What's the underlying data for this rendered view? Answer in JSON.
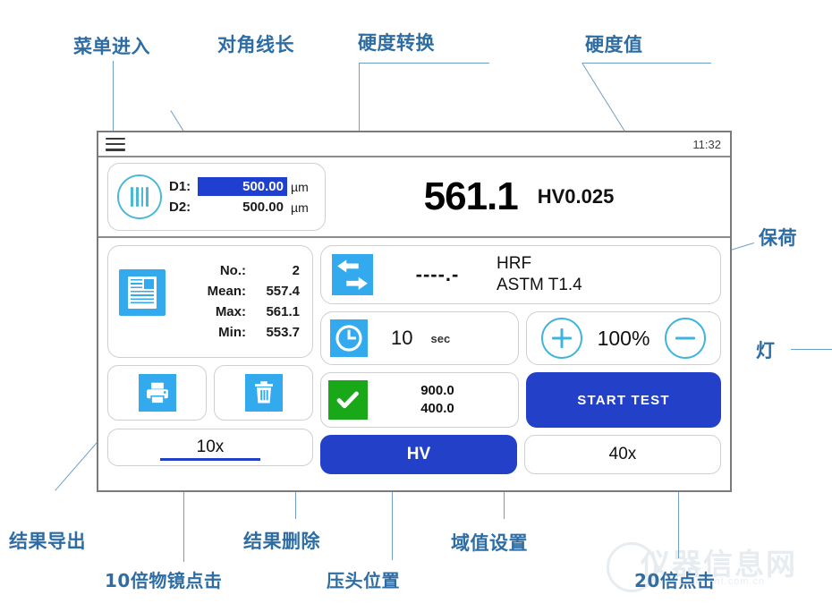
{
  "device": {
    "statusbar": {
      "menu_icon": "hamburger-menu-icon",
      "time": "11:32"
    },
    "diagonals": {
      "icon": "indentation-icon",
      "d1_label": "D1:",
      "d1_value": "500.00",
      "d1_unit": "µm",
      "d2_label": "D2:",
      "d2_value": "500.00",
      "d2_unit": "µm"
    },
    "hardness": {
      "value": "561.1",
      "scale": "HV0.025"
    },
    "statistics": {
      "icon": "document-report-icon",
      "rows": [
        {
          "key": "No.:",
          "value": "2"
        },
        {
          "key": "Mean:",
          "value": "557.4"
        },
        {
          "key": "Max:",
          "value": "561.1"
        },
        {
          "key": "Min:",
          "value": "553.7"
        }
      ]
    },
    "conversion": {
      "icon": "swap-arrows-icon",
      "value": "----.-",
      "scale": "HRF",
      "standard": "ASTM T1.4"
    },
    "dwell": {
      "icon": "clock-icon",
      "value": "10",
      "unit": "sec"
    },
    "light": {
      "plus_icon": "plus-circle-icon",
      "minus_icon": "minus-circle-icon",
      "value": "100%"
    },
    "export_button": {
      "icon": "printer-icon"
    },
    "delete_button": {
      "icon": "trash-icon"
    },
    "threshold": {
      "icon": "check-icon",
      "upper": "900.0",
      "lower": "400.0"
    },
    "start_test": {
      "label": "START TEST"
    },
    "objectives": {
      "left": "10x",
      "right": "40x"
    },
    "method": {
      "label": "HV"
    }
  },
  "annotations": {
    "menu_entry": "菜单进入",
    "diagonal_length": "对角线长",
    "hardness_conversion": "硬度转换",
    "hardness_value": "硬度值",
    "dwell_load": "保荷",
    "light": "灯",
    "export_result": "结果导出",
    "objective_10x_click": "10倍物镜点击",
    "delete_result": "结果删除",
    "indenter_position": "压头位置",
    "threshold_setting": "域值设置",
    "objective_20x_click": "20倍点击"
  },
  "watermark": {
    "text": "仪器信息网",
    "sub": "www.instrument.com.cn"
  },
  "colors": {
    "accent_blue": "#33aaee",
    "primary_blue": "#2340c8",
    "green": "#18a818",
    "cyan": "#3fb4dd",
    "annotation": "#2e6da4"
  }
}
